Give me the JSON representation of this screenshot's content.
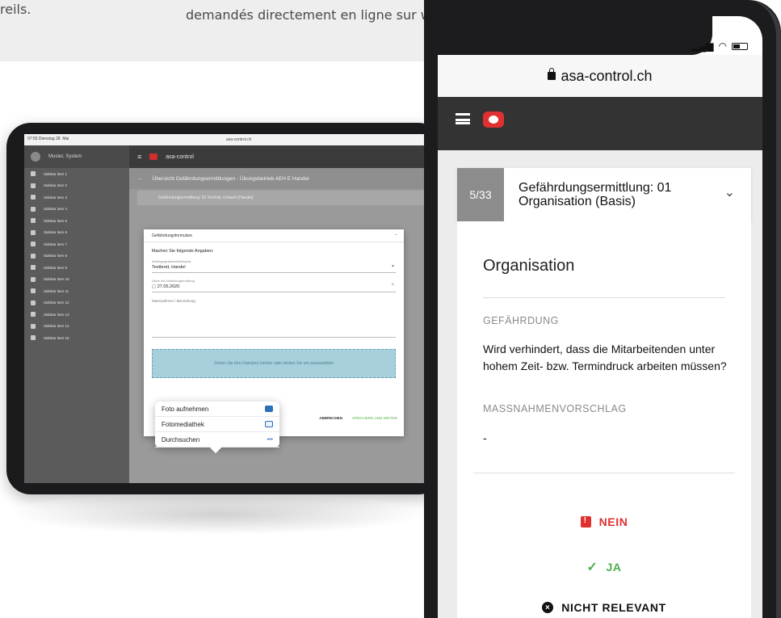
{
  "banner": {
    "text_left": "reils.",
    "text_right": "demandés directement en ligne sur www.aeh.ch."
  },
  "tablet": {
    "status_time": "07:55 Dienstag 28. Mai",
    "url": "asa-control.ch",
    "user_name": "Muster, System",
    "app_name": "asa-control",
    "breadcrumb": "Übersicht Gefährdungsermittlungen - Übungsbetrieb AEH E Handel",
    "sub_row": "Gefährdungsermittlung: 02 Technik, Umwelt (Handel)",
    "sidebar_items": [
      "Sidebar item 1",
      "Sidebar item 2",
      "Sidebar item 3",
      "Sidebar item 4",
      "Sidebar item 5",
      "Sidebar item 6",
      "Sidebar item 7",
      "Sidebar item 8",
      "Sidebar item 9",
      "Sidebar item 10",
      "Sidebar item 11",
      "Sidebar item 12",
      "Sidebar item 13",
      "Sidebar item 14",
      "Sidebar item 15"
    ],
    "dialog": {
      "header": "Gefährdungsformulare",
      "intro": "Machen Sie folgende Angaben:",
      "field1_label": "Arbeitsgegenstand/Arbeitsplatz",
      "field1_value": "Testbrett, Handel",
      "field2_label": "Datum der Gefährdungsermittlung",
      "field2_value": "27.05.2020",
      "note_label": "Massnahmen / Bemerkung",
      "drop_text": "Ziehen Sie Ihre Datei(en) hierher oder klicken Sie um auszuwählen",
      "abort": "ABBRECHEN",
      "save": "SPEICHERN UND WEITER"
    },
    "popup": {
      "items": [
        "Foto aufnehmen",
        "Fotomediathek",
        "Durchsuchen"
      ]
    }
  },
  "phone": {
    "url": "asa-control.ch",
    "step_count": "5/33",
    "step_title": "Gefährdungsermittlung: 01 Organisation (Basis)",
    "heading": "Organisation",
    "hazard_label": "GEFÄHRDUNG",
    "question": "Wird verhindert, dass die Mitarbeitenden unter hohem Zeit- bzw. Termindruck arbeiten müssen?",
    "measure_label": "MASSNAHMENVORSCHLAG",
    "measure_value": "-",
    "option_no": "NEIN",
    "option_yes": "JA",
    "option_na": "NICHT RELEVANT"
  },
  "colors": {
    "accent_red": "#e03131",
    "accent_green": "#4caf50",
    "appbar": "#333333"
  }
}
